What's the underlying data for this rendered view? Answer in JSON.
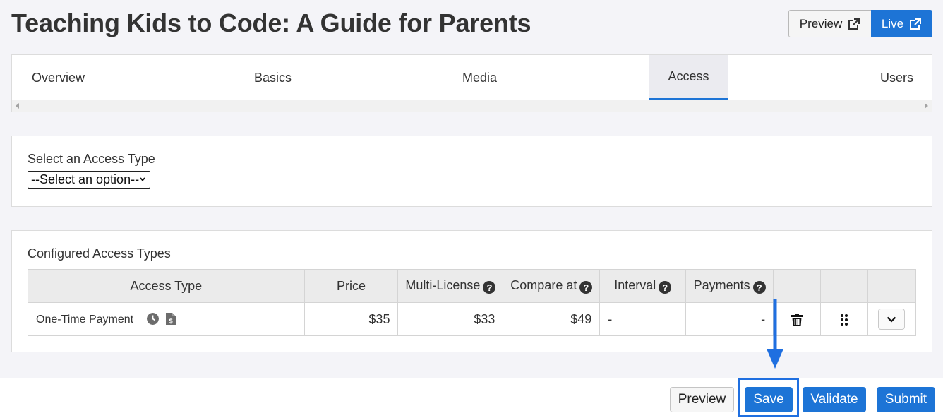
{
  "page": {
    "title": "Teaching Kids to Code: A Guide for Parents"
  },
  "top_actions": {
    "preview_label": "Preview",
    "live_label": "Live"
  },
  "tabs": [
    {
      "label": "Overview",
      "active": false
    },
    {
      "label": "Basics",
      "active": false
    },
    {
      "label": "Media",
      "active": false
    },
    {
      "label": "Access",
      "active": true
    },
    {
      "label": "Users",
      "active": false
    }
  ],
  "access_select": {
    "label": "Select an Access Type",
    "selected": "--Select an option--"
  },
  "configured": {
    "label": "Configured Access Types",
    "columns": [
      "Access Type",
      "Price",
      "Multi-License",
      "Compare at",
      "Interval",
      "Payments"
    ],
    "rows": [
      {
        "access_type": "One-Time Payment",
        "price": "$35",
        "multi_license": "$33",
        "compare_at": "$49",
        "interval": "-",
        "payments": "-"
      }
    ]
  },
  "bottom_actions": {
    "preview_label": "Preview",
    "save_label": "Save",
    "validate_label": "Validate",
    "submit_label": "Submit"
  },
  "colors": {
    "primary": "#1d74d6",
    "highlight": "#1f6fe0",
    "background": "#f4f4f8"
  }
}
